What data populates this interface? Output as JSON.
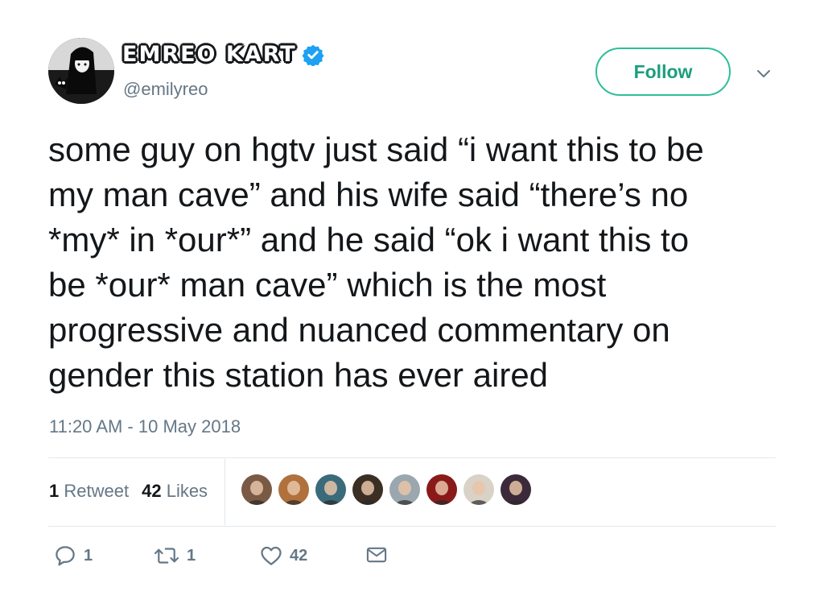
{
  "user": {
    "display_name": "EMREO KART",
    "handle": "@emilyreo",
    "verified_color": "#1da1f2"
  },
  "follow_label": "Follow",
  "tweet": {
    "text": "some guy on hgtv just said “i want this to be\nmy man cave” and his wife said “there’s no\n*my* in *our*” and he said “ok i want this to\nbe *our* man cave” which is the most\nprogressive and nuanced commentary on\ngender this station has ever aired",
    "timestamp": "11:20 AM - 10 May 2018"
  },
  "stats": {
    "retweet_count": "1",
    "retweet_label": "Retweet",
    "like_count": "42",
    "like_label": "Likes"
  },
  "likers": [
    {
      "color": "#7a5a44"
    },
    {
      "color": "#b0713c"
    },
    {
      "color": "#3a6b7a"
    },
    {
      "color": "#3b2f24"
    },
    {
      "color": "#9aa7ae"
    },
    {
      "color": "#8a1a1a"
    },
    {
      "color": "#d9d2c6"
    },
    {
      "color": "#3c2a3a"
    }
  ],
  "actions": {
    "reply_count": "1",
    "retweet_count": "1",
    "like_count": "42"
  },
  "colors": {
    "accent": "#1b9e7e",
    "muted": "#657786",
    "divider": "#e1e8ed"
  },
  "icons": [
    "avatar",
    "verified-icon",
    "chevron-down-icon",
    "reply-icon",
    "retweet-icon",
    "heart-icon",
    "message-icon"
  ]
}
